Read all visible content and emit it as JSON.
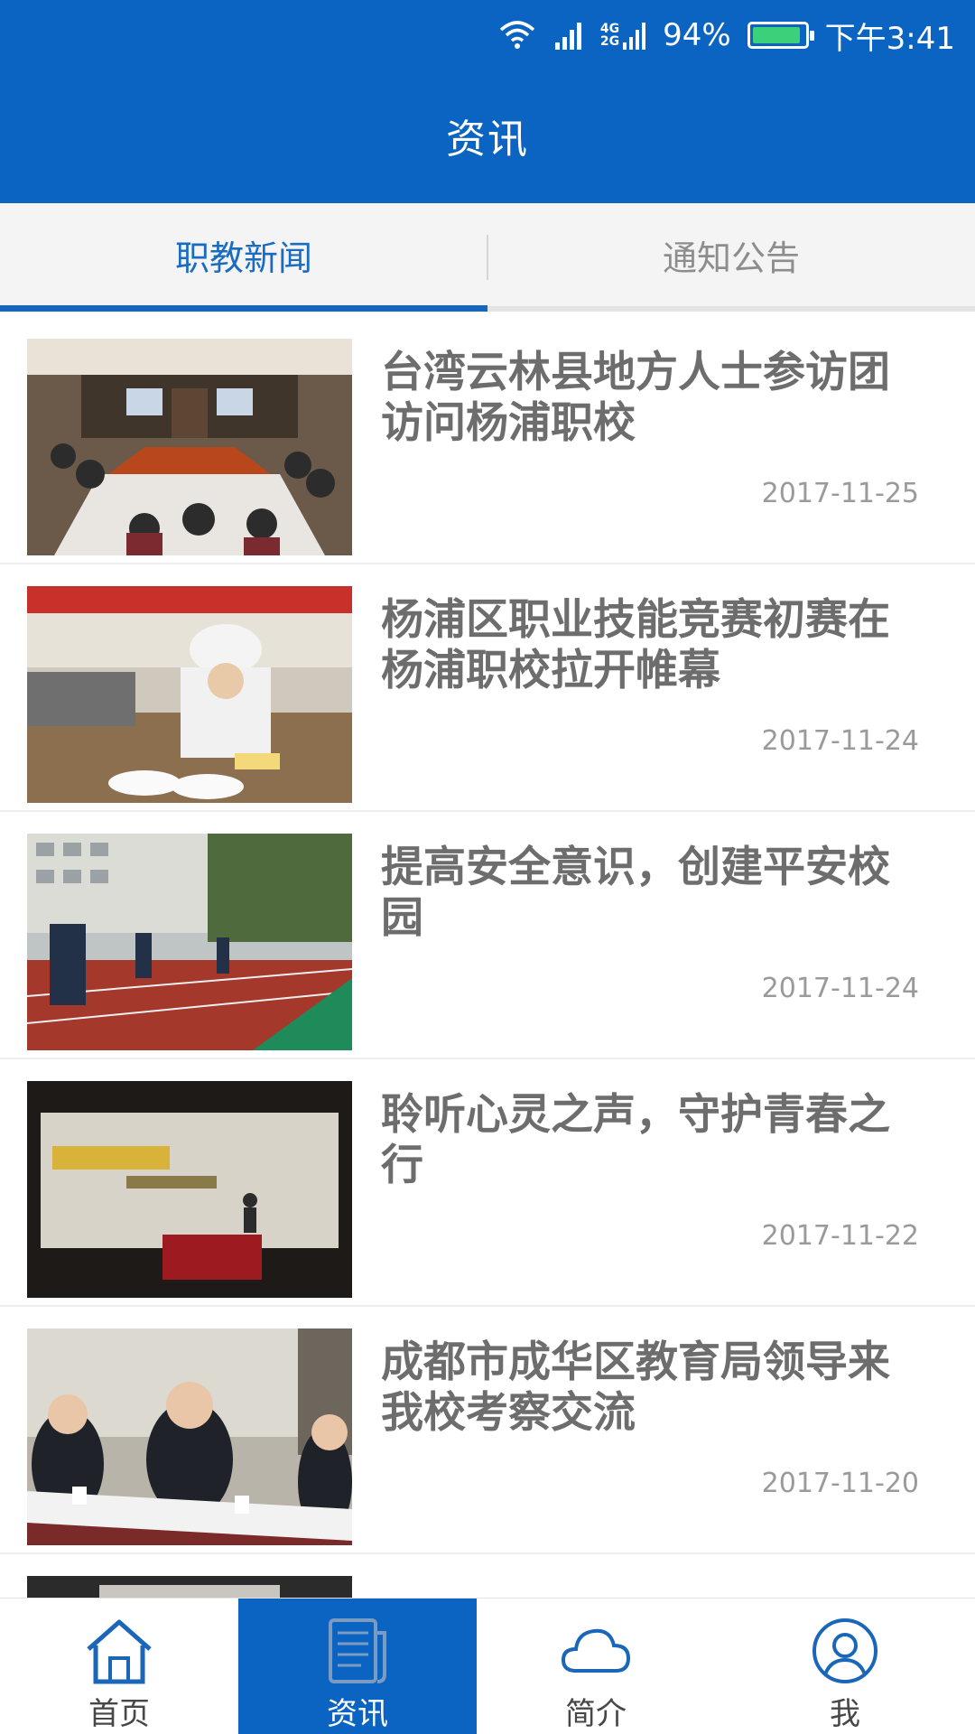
{
  "status_bar": {
    "battery": "94%",
    "time": "下午3:41",
    "network_top": "4G",
    "network_bottom": "2G"
  },
  "header": {
    "title": "资讯"
  },
  "tabs": [
    {
      "label": "职教新闻",
      "active": true
    },
    {
      "label": "通知公告",
      "active": false
    }
  ],
  "news": [
    {
      "title": "台湾云林县地方人士参访团访问杨浦职校",
      "date": "2017-11-25",
      "image": "meeting-room-photo"
    },
    {
      "title": "杨浦区职业技能竞赛初赛在杨浦职校拉开帷幕",
      "date": "2017-11-24",
      "image": "cooking-contest-photo"
    },
    {
      "title": "提高安全意识，创建平安校园",
      "date": "2017-11-24",
      "image": "campus-drill-photo"
    },
    {
      "title": "聆听心灵之声，守护青春之行",
      "date": "2017-11-22",
      "image": "lecture-hall-photo"
    },
    {
      "title": "成都市成华区教育局领导来我校考察交流",
      "date": "2017-11-20",
      "image": "visitors-meeting-photo"
    }
  ],
  "bottom_nav": [
    {
      "label": "首页",
      "icon": "home-icon",
      "active": false
    },
    {
      "label": "资讯",
      "icon": "news-icon",
      "active": true
    },
    {
      "label": "简介",
      "icon": "cloud-icon",
      "active": false
    },
    {
      "label": "我",
      "icon": "user-icon",
      "active": false
    }
  ],
  "colors": {
    "primary": "#0b64c1",
    "battery": "#3bd07a"
  }
}
